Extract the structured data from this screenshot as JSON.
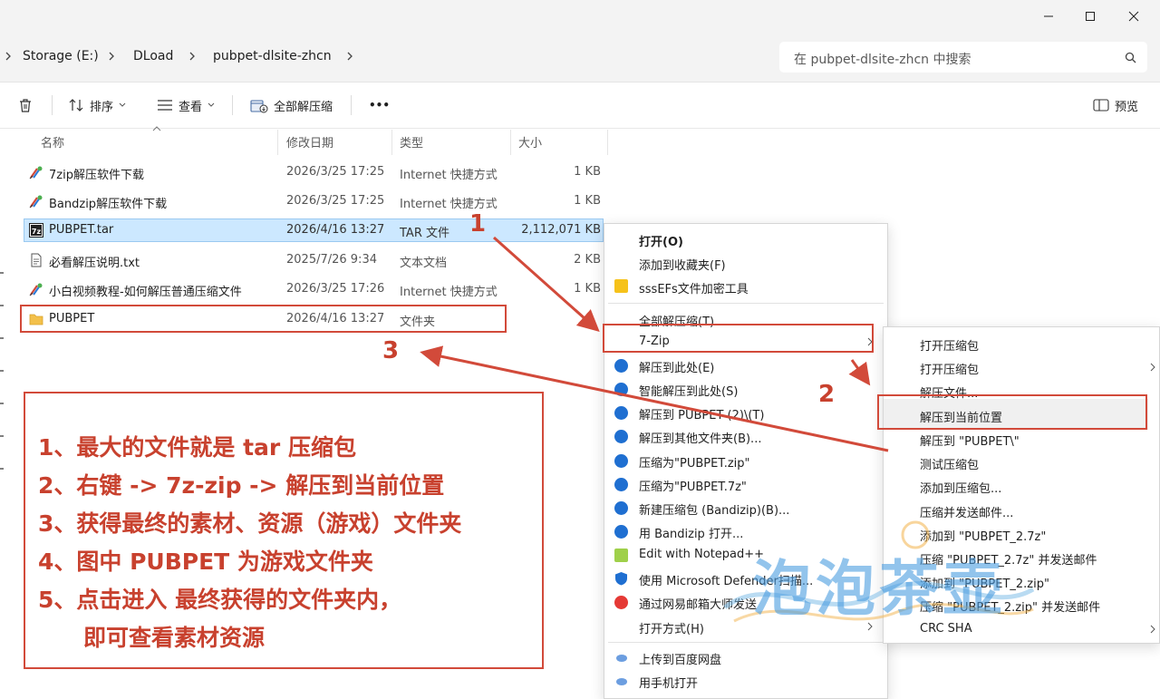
{
  "breadcrumb": [
    "Storage (E:)",
    "DLoad",
    "pubpet-dlsite-zhcn"
  ],
  "search": {
    "placeholder": "在 pubpet-dlsite-zhcn 中搜索"
  },
  "toolbar": {
    "sort": "排序",
    "view": "查看",
    "extract_all": "全部解压缩",
    "more": "•••",
    "preview": "预览"
  },
  "columns": {
    "name": "名称",
    "date": "修改日期",
    "type": "类型",
    "size": "大小"
  },
  "files": [
    {
      "name": "7zip解压软件下载",
      "date": "2026/3/25 17:25",
      "type": "Internet 快捷方式",
      "size": "1 KB"
    },
    {
      "name": "Bandzip解压软件下载",
      "date": "2026/3/25 17:25",
      "type": "Internet 快捷方式",
      "size": "1 KB"
    },
    {
      "name": "PUBPET.tar",
      "date": "2026/4/16 13:27",
      "type": "TAR 文件",
      "size": "2,112,071 KB"
    },
    {
      "name": "必看解压说明.txt",
      "date": "2025/7/26 9:34",
      "type": "文本文档",
      "size": "2 KB"
    },
    {
      "name": "小白视频教程-如何解压普通压缩文件",
      "date": "2026/3/25 17:26",
      "type": "Internet 快捷方式",
      "size": "1 KB"
    },
    {
      "name": "PUBPET",
      "date": "2026/4/16 13:27",
      "type": "文件夹",
      "size": ""
    }
  ],
  "context_menu": {
    "open": "打开(O)",
    "favorite": "添加到收藏夹(F)",
    "encrypt": "sssEFs文件加密工具",
    "extract_all": "全部解压缩(T)...",
    "sevenzip": "7-Zip",
    "extract_here": "解压到此处(E)",
    "smart_extract": "智能解压到此处(S)",
    "extract_to_folder": "解压到 PUBPET (2)\\(T)",
    "extract_other": "解压到其他文件夹(B)...",
    "compress_zip": "压缩为\"PUBPET.zip\"",
    "compress_7z": "压缩为\"PUBPET.7z\"",
    "new_archive": "新建压缩包 (Bandizip)(B)...",
    "open_bandizip": "用 Bandizip 打开...",
    "notepad": "Edit with Notepad++",
    "defender": "使用 Microsoft Defender扫描...",
    "mail": "通过网易邮箱大师发送",
    "open_with": "打开方式(H)",
    "baidu": "上传到百度网盘",
    "phone": "用手机打开"
  },
  "submenu": {
    "open_archive": "打开压缩包",
    "open_archive2": "打开压缩包",
    "extract_files": "解压文件...",
    "extract_here": "解压到当前位置",
    "extract_to": "解压到 \"PUBPET\\\"",
    "test": "测试压缩包",
    "add": "添加到压缩包...",
    "compress_mail": "压缩并发送邮件...",
    "add_7z": "添加到 \"PUBPET_2.7z\"",
    "compress_7z_mail": "压缩 \"PUBPET_2.7z\" 并发送邮件",
    "add_zip": "添加到 \"PUBPET_2.zip\"",
    "compress_zip_mail": "压缩 \"PUBPET_2.zip\" 并发送邮件",
    "crc": "CRC SHA"
  },
  "steps": [
    "1",
    "2",
    "3"
  ],
  "instructions": [
    "1、最大的文件就是 tar 压缩包",
    "2、右键 -> 7z-zip -> 解压到当前位置",
    "3、获得最终的素材、资源（游戏）文件夹",
    "4、图中 PUBPET 为游戏文件夹",
    "5、点击进入 最终获得的文件夹内，",
    "即可查看素材资源"
  ],
  "watermark": "泡泡茶壶",
  "colors": {
    "annotation_red": "#d24a3a",
    "selection": "#cce8ff",
    "menu_icon_blue": "#1f6fd1",
    "folder_yellow": "#f3c04a"
  }
}
